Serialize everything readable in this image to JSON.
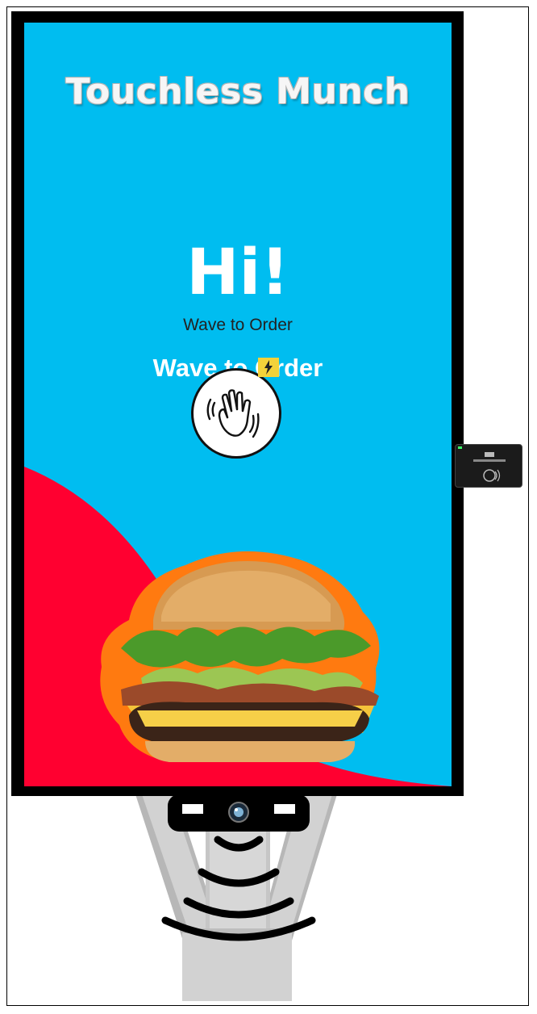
{
  "app": {
    "title": "Touchless Munch"
  },
  "screen": {
    "greeting": "Hi!",
    "subtitle": "Wave to Order",
    "wave_heading": "Wave to Order",
    "wave_button_icon": "waving-hand-icon",
    "flash_badge_icon": "lightning-bolt-icon"
  },
  "hardware": {
    "card_reader_icon": "contactless-card-reader-icon",
    "camera_icon": "camera-icon",
    "sensor_waves_icon": "motion-sensor-waves-icon"
  },
  "colors": {
    "screen_background": "#00bdf0",
    "accent_red": "#ff0030",
    "text_white": "#ffffff"
  }
}
